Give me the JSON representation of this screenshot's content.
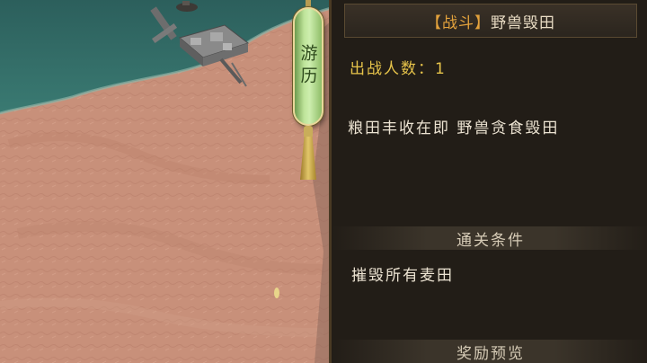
{
  "scroll_tab": {
    "label": "游历"
  },
  "panel": {
    "title_tag": "【战斗】",
    "title_name": "野兽毁田",
    "participants": "出战人数：1",
    "description": "粮田丰收在即 野兽贪食毁田",
    "condition_header": "通关条件",
    "condition_text": "摧毁所有麦田",
    "reward_header": "奖励预览"
  },
  "colors": {
    "sea": "#2f6b67",
    "land": "#c8907a",
    "panel_bg": "#221d17",
    "accent_orange": "#e3a23c",
    "accent_gold": "#e6c34a",
    "scroll_green": "#bfe49a"
  }
}
